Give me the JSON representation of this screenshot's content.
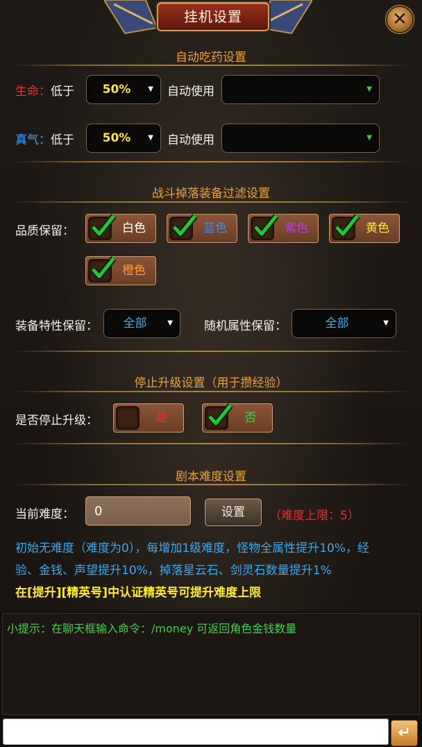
{
  "window": {
    "title": "挂机设置"
  },
  "potion": {
    "title": "自动吃药设置",
    "hp": {
      "name": "生命：",
      "below": "低于",
      "percent": "50%",
      "auto_use": "自动使用",
      "item": ""
    },
    "mp": {
      "name": "真气：",
      "below": "低于",
      "percent": "50%",
      "auto_use": "自动使用",
      "item": ""
    }
  },
  "filter": {
    "title": "战斗掉落装备过滤设置",
    "quality_label": "品质保留：",
    "qualities": [
      {
        "label": "白色",
        "color": "#ffffff",
        "checked": true
      },
      {
        "label": "蓝色",
        "color": "#3a8fe8",
        "checked": true
      },
      {
        "label": "紫色",
        "color": "#b43fe6",
        "checked": true
      },
      {
        "label": "黄色",
        "color": "#ffe838",
        "checked": true
      },
      {
        "label": "橙色",
        "color": "#ff9a2e",
        "checked": true
      }
    ],
    "trait_label": "装备特性保留：",
    "trait_value": "全部",
    "random_label": "随机属性保留：",
    "random_value": "全部"
  },
  "levelup": {
    "title": "停止升级设置（用于攒经验）",
    "label": "是否停止升级：",
    "yes": {
      "label": "是",
      "color": "#e8312a",
      "checked": false
    },
    "no": {
      "label": "否",
      "color": "#3fd04a",
      "checked": true
    }
  },
  "difficulty": {
    "title": "剧本难度设置",
    "label": "当前难度：",
    "value": "0",
    "set_button": "设置",
    "limit": "（难度上限：5）",
    "desc_line1": "初始无难度（难度为0），每增加1级难度，怪物全属性提升10%，经",
    "desc_line2": "验、金钱、声望提升10%，掉落星云石、剑灵石数量提升1%",
    "desc_line3": "在[提升][精英号]中认证精英号可提升难度上限"
  },
  "chat": {
    "tip": "小提示：在聊天框输入命令：/money 可返回角色金钱数量",
    "input_value": "",
    "send_icon": "return-arrow-icon"
  },
  "colors": {
    "accent": "#e9a23a",
    "link_blue": "#3aa8ee",
    "tip_green": "#3fd04a"
  }
}
